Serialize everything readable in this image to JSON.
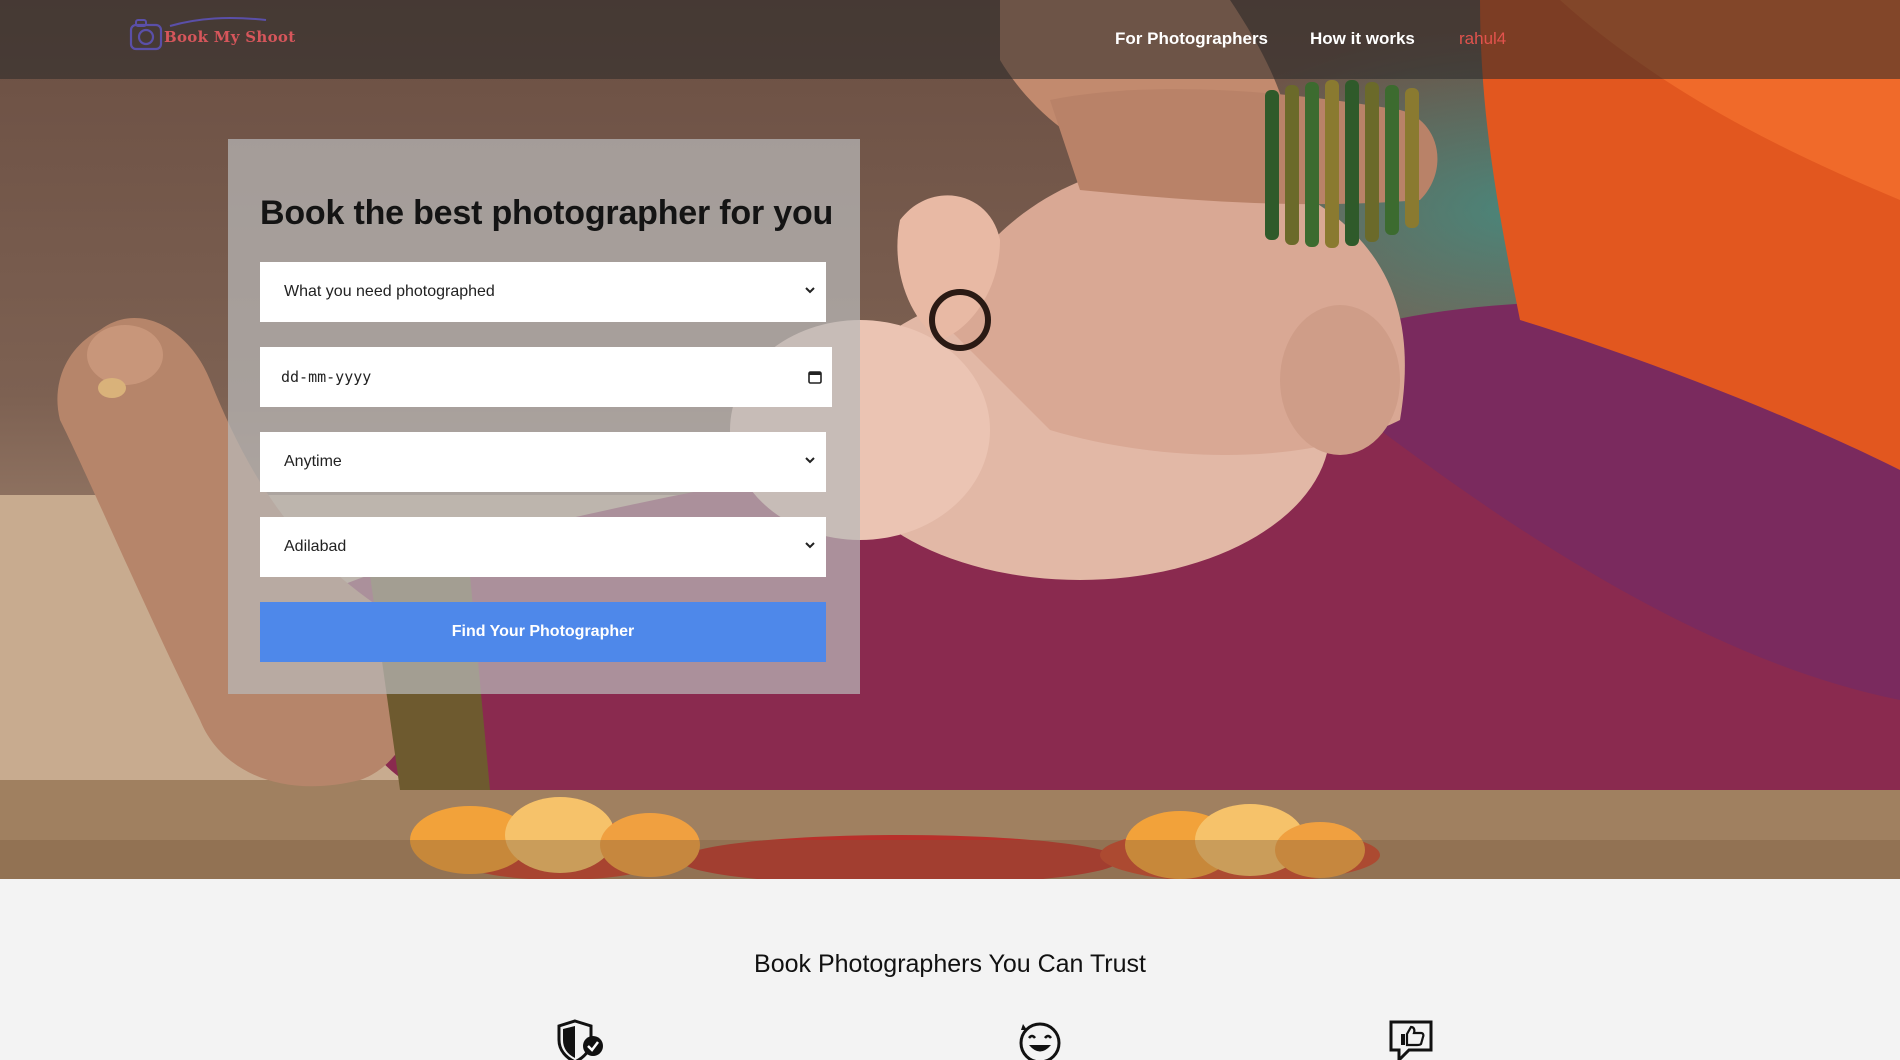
{
  "header": {
    "logo_text": "Book My Shoot",
    "nav": [
      {
        "label": "For Photographers"
      },
      {
        "label": "How it works"
      },
      {
        "label": "rahul4"
      }
    ]
  },
  "hero": {
    "headline": "Book the best photographer for you",
    "fields": {
      "service": {
        "value": "What you need photographed",
        "icon": "chevron-down-icon"
      },
      "date": {
        "placeholder": "dd-mm-yyyy",
        "icon": "calendar-icon"
      },
      "time": {
        "value": "Anytime",
        "icon": "chevron-down-icon"
      },
      "city": {
        "value": "Adilabad",
        "icon": "chevron-down-icon"
      }
    },
    "cta_label": "Find Your Photographer"
  },
  "trust": {
    "title": "Book Photographers You Can Trust",
    "icons": [
      "shield-check-icon",
      "happy-face-icon",
      "thumbs-up-chat-icon"
    ]
  },
  "colors": {
    "accent": "#4e88ea",
    "brand": "#d6565b",
    "header_bg": "#3a3a3a",
    "page_bg": "#f3f3f3"
  }
}
